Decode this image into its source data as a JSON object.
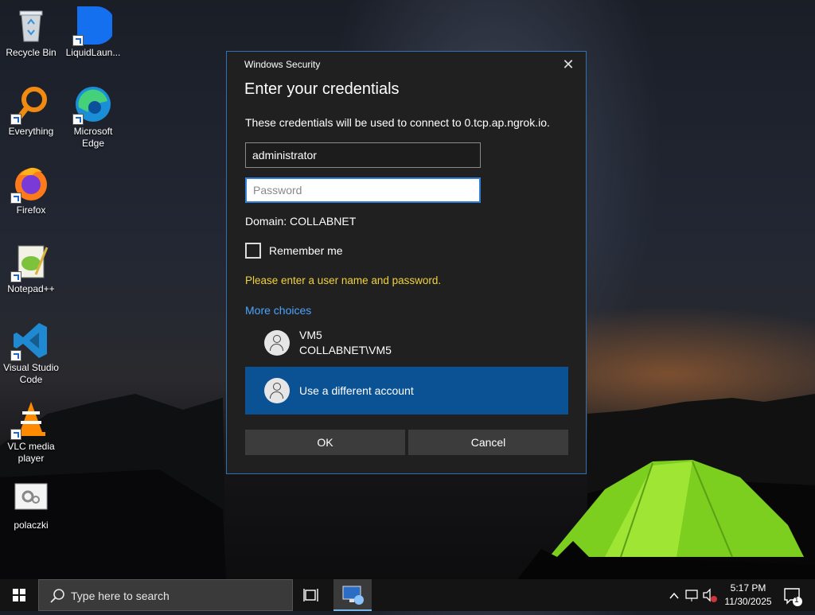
{
  "desktop_icons": [
    {
      "label": "Recycle Bin",
      "icon": "recycle-bin-icon"
    },
    {
      "label": "LiquidLaun...",
      "icon": "liquidlauncher-icon"
    },
    {
      "label": "Everything",
      "icon": "everything-search-icon"
    },
    {
      "label": "Microsoft Edge",
      "icon": "edge-icon"
    },
    {
      "label": "Firefox",
      "icon": "firefox-icon"
    },
    {
      "label": "Notepad++",
      "icon": "notepadpp-icon"
    },
    {
      "label": "Visual Studio Code",
      "icon": "vscode-icon"
    },
    {
      "label": "VLC media player",
      "icon": "vlc-icon"
    },
    {
      "label": "polaczki",
      "icon": "connection-file-icon"
    }
  ],
  "dialog": {
    "window_title": "Windows Security",
    "heading": "Enter your credentials",
    "description": "These credentials will be used to connect to 0.tcp.ap.ngrok.io.",
    "username_value": "administrator",
    "password_placeholder": "Password",
    "domain": "Domain: COLLABNET",
    "remember_label": "Remember me",
    "warning": "Please enter a user name and password.",
    "more_choices": "More choices",
    "accounts": [
      {
        "name": "VM5",
        "detail": "COLLABNET\\VM5"
      },
      {
        "name": "Use a different account",
        "detail": ""
      }
    ],
    "ok_label": "OK",
    "cancel_label": "Cancel",
    "close_glyph": "✕"
  },
  "taskbar": {
    "search_placeholder": "Type here to search",
    "time": "5:17 PM",
    "date": "11/30/2025",
    "notification_count": "1"
  },
  "colors": {
    "accent": "#0b5294",
    "warning": "#f0d23a",
    "link": "#4aa3ff"
  }
}
